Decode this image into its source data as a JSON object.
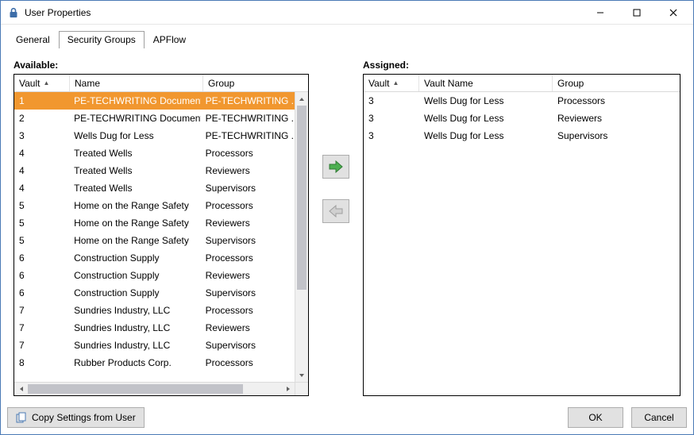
{
  "window": {
    "title": "User Properties"
  },
  "tabs": [
    {
      "label": "General",
      "active": false
    },
    {
      "label": "Security Groups",
      "active": true
    },
    {
      "label": "APFlow",
      "active": false
    }
  ],
  "available": {
    "label": "Available:",
    "headers": {
      "vault": "Vault",
      "name": "Name",
      "group": "Group"
    },
    "rows": [
      {
        "vault": "1",
        "name": "PE-TECHWRITING Documents",
        "group": "PE-TECHWRITING ...",
        "selected": true
      },
      {
        "vault": "2",
        "name": "PE-TECHWRITING Documents ...",
        "group": "PE-TECHWRITING ..."
      },
      {
        "vault": "3",
        "name": "Wells Dug for Less",
        "group": "PE-TECHWRITING ..."
      },
      {
        "vault": "4",
        "name": "Treated Wells",
        "group": "Processors"
      },
      {
        "vault": "4",
        "name": "Treated Wells",
        "group": "Reviewers"
      },
      {
        "vault": "4",
        "name": "Treated Wells",
        "group": "Supervisors"
      },
      {
        "vault": "5",
        "name": "Home on the Range Safety",
        "group": "Processors"
      },
      {
        "vault": "5",
        "name": "Home on the Range Safety",
        "group": "Reviewers"
      },
      {
        "vault": "5",
        "name": "Home on the Range Safety",
        "group": "Supervisors"
      },
      {
        "vault": "6",
        "name": "Construction Supply",
        "group": "Processors"
      },
      {
        "vault": "6",
        "name": "Construction Supply",
        "group": "Reviewers"
      },
      {
        "vault": "6",
        "name": "Construction Supply",
        "group": "Supervisors"
      },
      {
        "vault": "7",
        "name": "Sundries Industry, LLC",
        "group": "Processors"
      },
      {
        "vault": "7",
        "name": "Sundries Industry, LLC",
        "group": "Reviewers"
      },
      {
        "vault": "7",
        "name": "Sundries Industry, LLC",
        "group": "Supervisors"
      },
      {
        "vault": "8",
        "name": "Rubber Products Corp.",
        "group": "Processors"
      }
    ]
  },
  "assigned": {
    "label": "Assigned:",
    "headers": {
      "vault": "Vault",
      "name": "Vault Name",
      "group": "Group"
    },
    "rows": [
      {
        "vault": "3",
        "name": "Wells Dug for Less",
        "group": "Processors"
      },
      {
        "vault": "3",
        "name": "Wells Dug for Less",
        "group": "Reviewers"
      },
      {
        "vault": "3",
        "name": "Wells Dug for Less",
        "group": "Supervisors"
      }
    ]
  },
  "buttons": {
    "copy": "Copy Settings from User",
    "ok": "OK",
    "cancel": "Cancel"
  }
}
